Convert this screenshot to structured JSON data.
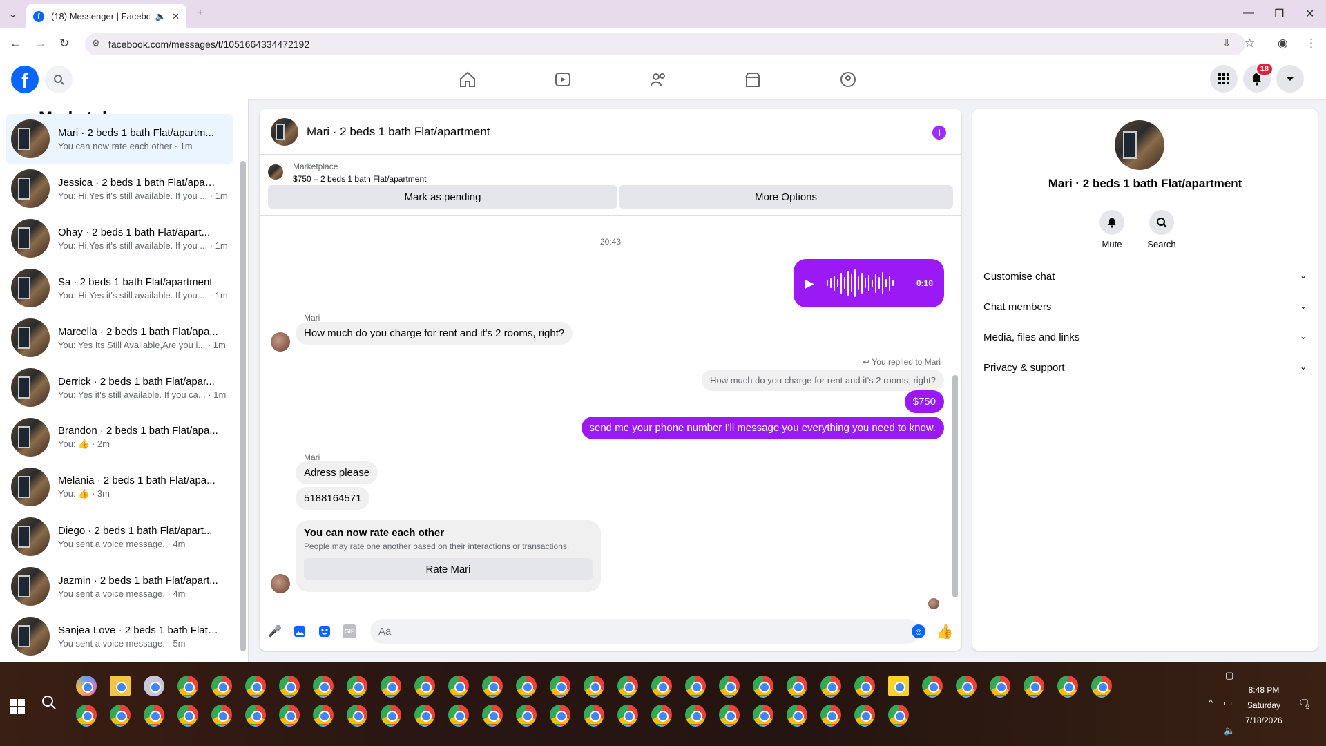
{
  "browser": {
    "tab_title": "(18) Messenger | Facebook",
    "tab_audio_icon": "speaker-icon",
    "url": "facebook.com/messages/t/1051664334472192"
  },
  "facebook": {
    "notification_count": "18",
    "brand_color": "#0866ff"
  },
  "sidebar": {
    "title": "Marketplace",
    "conversations": [
      {
        "name": "Mari · 2 beds 1 bath Flat/apartm...",
        "preview": "You can now rate each other · 1m",
        "active": true
      },
      {
        "name": "Jessica · 2 beds 1 bath Flat/apart...",
        "preview": "You: Hi,Yes it's still available. If you ... · 1m"
      },
      {
        "name": "Ohay · 2 beds 1 bath Flat/apart...",
        "preview": "You: Hi,Yes it's still available. If you ... · 1m"
      },
      {
        "name": "Sa · 2 beds 1 bath Flat/apartment",
        "preview": "You: Hi,Yes it's still available. If you ... · 1m"
      },
      {
        "name": "Marcella · 2 beds 1 bath Flat/apa...",
        "preview": "You: Yes Its Still Available,Are you i... · 1m"
      },
      {
        "name": "Derrick · 2 beds 1 bath Flat/apar...",
        "preview": "You: Yes it's still available. If you ca... · 1m"
      },
      {
        "name": "Brandon · 2 beds 1 bath Flat/apa...",
        "preview": "You: 👍 · 2m"
      },
      {
        "name": "Melania · 2 beds 1 bath Flat/apa...",
        "preview": "You: 👍 · 3m"
      },
      {
        "name": "Diego · 2 beds 1 bath Flat/apart...",
        "preview": "You sent a voice message. · 4m"
      },
      {
        "name": "Jazmin · 2 beds 1 bath Flat/apart...",
        "preview": "You sent a voice message. · 4m"
      },
      {
        "name": "Sanjea Love · 2 beds 1 bath Flat/...",
        "preview": "You sent a voice message. · 5m"
      }
    ]
  },
  "chat": {
    "title": "Mari · 2 beds 1 bath Flat/apartment",
    "marketplace_label": "Marketplace",
    "listing": "$750 – 2 beds 1 bath Flat/apartment",
    "mark_pending": "Mark as pending",
    "more_options": "More Options",
    "timestamp": "20:43",
    "voice_duration": "0:10",
    "sender_name": "Mari",
    "msg_in_1": "How much do you charge for rent and it's 2 rooms, right?",
    "replied_label": "You replied to Mari",
    "quoted": "How much do you charge for rent and it's 2 rooms, right?",
    "msg_out_1": "$750",
    "msg_out_2": "send me your phone number I'll message you everything you need to know.",
    "msg_in_2": "Adress please",
    "msg_in_3": "5188164571",
    "rate_title": "You can now rate each other",
    "rate_sub": "People may rate one another based on their interactions or transactions.",
    "rate_button": "Rate Mari",
    "composer_placeholder": "Aa",
    "accent_color": "#9b19f5"
  },
  "details": {
    "title": "Mari · 2 beds 1 bath Flat/apartment",
    "mute": "Mute",
    "search": "Search",
    "sections": [
      "Customise chat",
      "Chat members",
      "Media, files and links",
      "Privacy & support"
    ]
  },
  "taskbar": {
    "time": "8:48 PM",
    "day": "Saturday",
    "date": "7/18/2026",
    "notifications": "2"
  }
}
